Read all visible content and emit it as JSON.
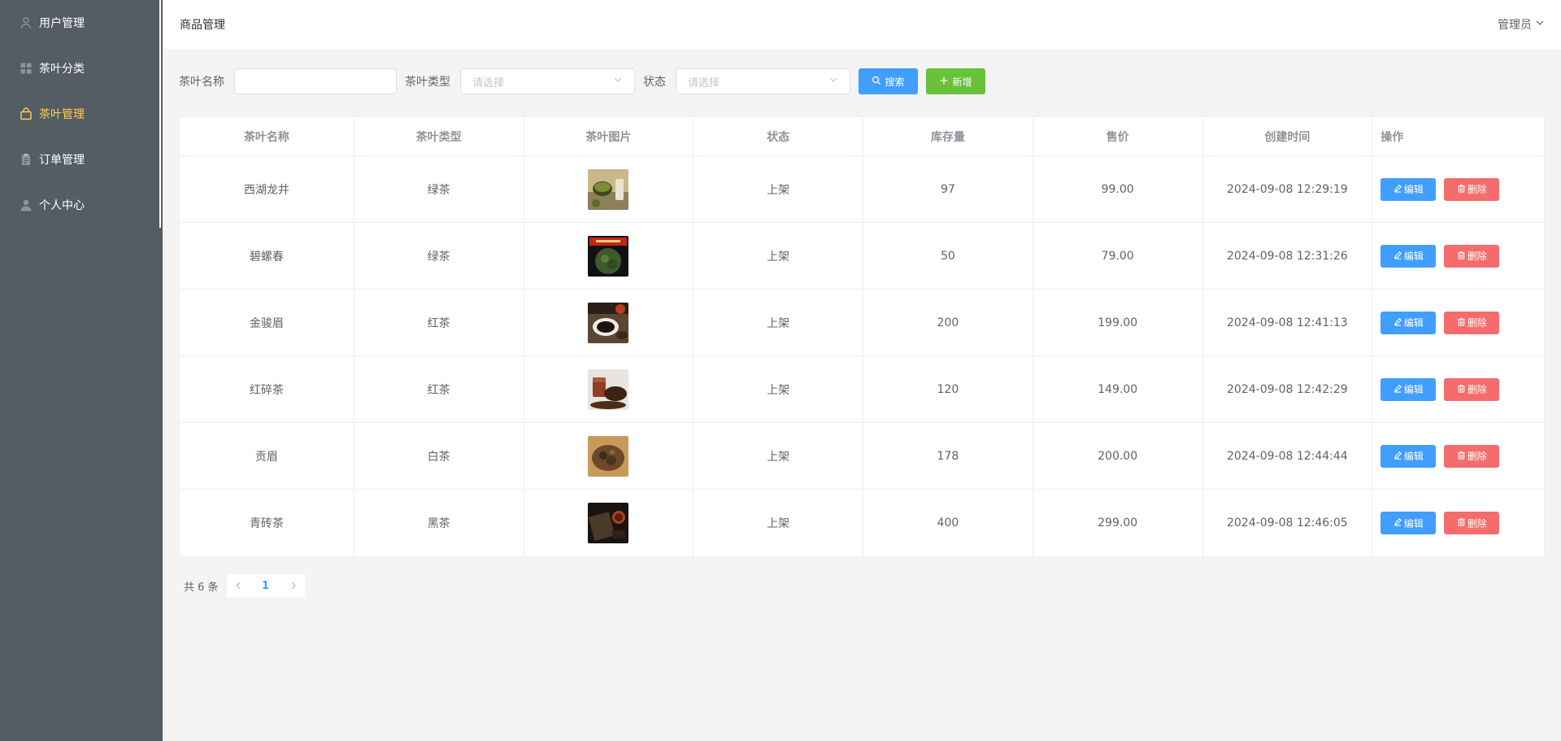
{
  "sidebar": {
    "items": [
      {
        "label": "用户管理",
        "icon": "user-icon"
      },
      {
        "label": "茶叶分类",
        "icon": "grid-icon"
      },
      {
        "label": "茶叶管理",
        "icon": "bag-icon"
      },
      {
        "label": "订单管理",
        "icon": "clipboard-icon"
      },
      {
        "label": "个人中心",
        "icon": "person-icon"
      }
    ],
    "active_index": 2,
    "active_color": "#ffd04b",
    "bg_color": "#545c64"
  },
  "header": {
    "breadcrumb": "商品管理",
    "user_label": "管理员"
  },
  "search": {
    "name_label": "茶叶名称",
    "name_value": "",
    "type_label": "茶叶类型",
    "type_placeholder": "请选择",
    "status_label": "状态",
    "status_placeholder": "请选择",
    "search_button": "搜索",
    "add_button": "新增"
  },
  "table": {
    "columns": [
      "茶叶名称",
      "茶叶类型",
      "茶叶图片",
      "状态",
      "库存量",
      "售价",
      "创建时间",
      "操作"
    ],
    "edit_label": "编辑",
    "delete_label": "删除",
    "rows": [
      {
        "name": "西湖龙井",
        "type": "绿茶",
        "status": "上架",
        "stock": "97",
        "price": "99.00",
        "created": "2024-09-08 12:29:19"
      },
      {
        "name": "碧螺春",
        "type": "绿茶",
        "status": "上架",
        "stock": "50",
        "price": "79.00",
        "created": "2024-09-08 12:31:26"
      },
      {
        "name": "金骏眉",
        "type": "红茶",
        "status": "上架",
        "stock": "200",
        "price": "199.00",
        "created": "2024-09-08 12:41:13"
      },
      {
        "name": "红碎茶",
        "type": "红茶",
        "status": "上架",
        "stock": "120",
        "price": "149.00",
        "created": "2024-09-08 12:42:29"
      },
      {
        "name": "贡眉",
        "type": "白茶",
        "status": "上架",
        "stock": "178",
        "price": "200.00",
        "created": "2024-09-08 12:44:44"
      },
      {
        "name": "青砖茶",
        "type": "黑茶",
        "status": "上架",
        "stock": "400",
        "price": "299.00",
        "created": "2024-09-08 12:46:05"
      }
    ]
  },
  "pagination": {
    "total_text": "共 6 条",
    "current_page": "1"
  },
  "colors": {
    "primary": "#409eff",
    "success": "#67c23a",
    "danger": "#f56c6c"
  }
}
